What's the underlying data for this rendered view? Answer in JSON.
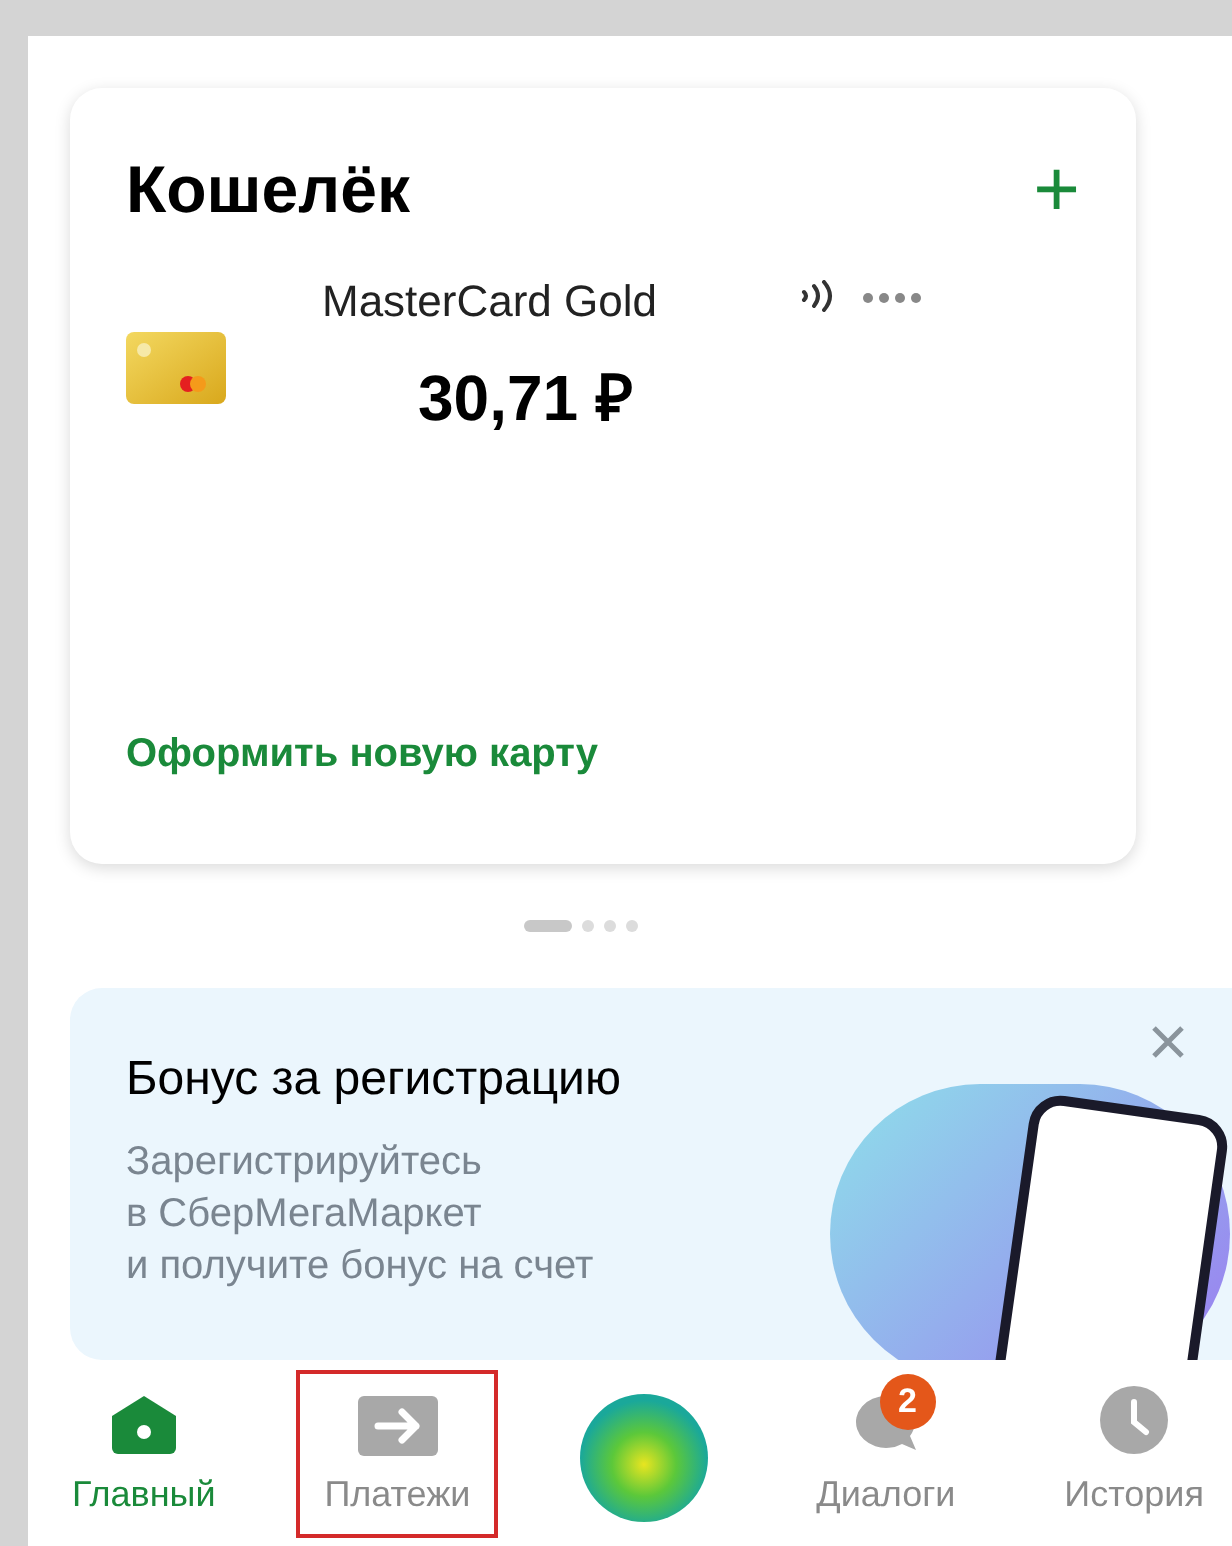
{
  "wallet": {
    "title": "Кошелёк",
    "add_icon": "+",
    "card": {
      "name": "MasterCard Gold",
      "balance": "30,71 ₽"
    },
    "new_card_link": "Оформить новую карту"
  },
  "pager": [
    {
      "selected": true
    },
    {
      "selected": false
    },
    {
      "selected": false
    },
    {
      "selected": false
    }
  ],
  "promo": {
    "title": "Бонус за регистрацию",
    "text": [
      "Зарегистрируйтесь",
      "в СберМегаМаркет",
      "и получите бонус на счет"
    ]
  },
  "nav": [
    {
      "kind": "home",
      "label": "Главный",
      "selected": true,
      "highlighted": false
    },
    {
      "kind": "payments",
      "label": "Платежи",
      "selected": false,
      "highlighted": true
    },
    {
      "kind": "assistant",
      "highlighted": false
    },
    {
      "kind": "dialogs",
      "label": "Диалоги",
      "selected": false,
      "highlighted": false,
      "badge": "2"
    },
    {
      "kind": "history",
      "label": "История",
      "selected": false,
      "highlighted": false
    }
  ]
}
